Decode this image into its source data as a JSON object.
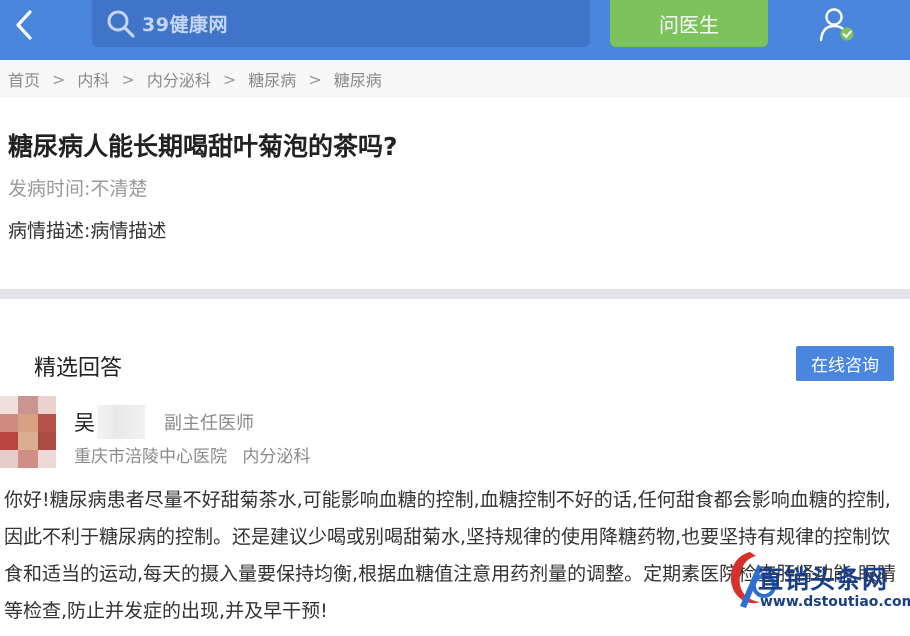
{
  "header": {
    "search_logo": "39健康网",
    "ask_label": "问医生"
  },
  "breadcrumb": [
    "首页",
    "内科",
    "内分泌科",
    "糖尿病",
    "糖尿病"
  ],
  "breadcrumb_sep": ">",
  "question": {
    "title": "糖尿病人能长期喝甜叶菊泡的茶吗?",
    "onset": "发病时间:不清楚",
    "description": "病情描述:病情描述"
  },
  "answers": {
    "section_title": "精选回答",
    "consult_label": "在线咨询",
    "doctor": {
      "name": "吴",
      "title": "副主任医师",
      "hospital": "重庆市涪陵中心医院",
      "department": "内分泌科"
    },
    "text": "你好!糖尿病患者尽量不好甜菊茶水,可能影响血糖的控制,血糖控制不好的话,任何甜食都会影响血糖的控制,因此不利于糖尿病的控制。还是建议少喝或别喝甜菊水,坚持规律的使用降糖药物,也要坚持有规律的控制饮食和适当的运动,每天的摄入量要保持均衡,根据血糖值注意用药剂量的调整。定期素医院检查肝肾功能,眼睛等检查,防止并发症的出现,并及早干预!"
  },
  "watermark": {
    "name": "直销头条网",
    "url": "www.dstoutiao.com"
  },
  "colors": {
    "header": "#4a86de",
    "search_bg": "#3f74c9",
    "ask_button": "#7bc35a",
    "consult_button": "#4a86de"
  },
  "icons": [
    "back-arrow-icon",
    "search-icon",
    "user-verified-icon"
  ]
}
